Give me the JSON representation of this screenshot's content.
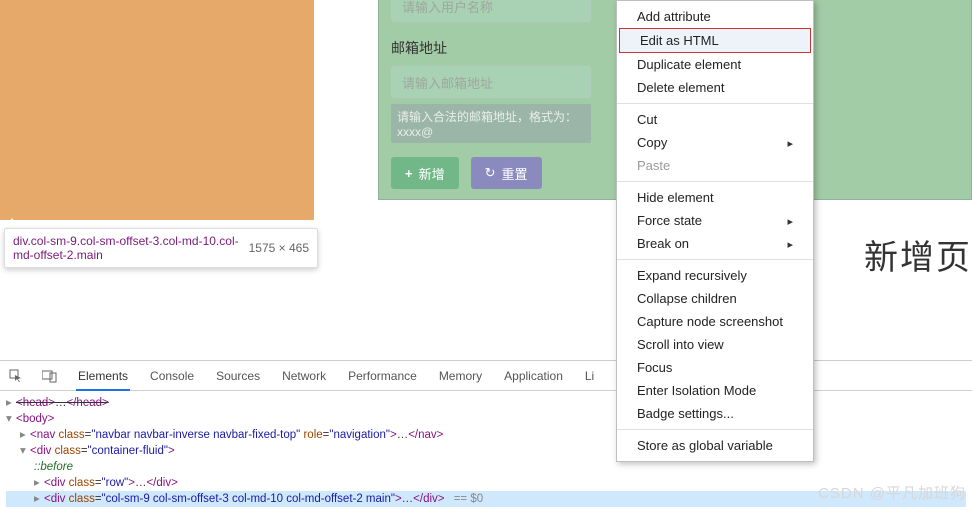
{
  "tooltip": {
    "selector": "div.col-sm-9.col-sm-offset-3.col-md-10.col-md-offset-2.main",
    "dimensions": "1575 × 465"
  },
  "form": {
    "username_placeholder": "请输入用户名称",
    "email_label": "邮箱地址",
    "email_placeholder": "请输入邮箱地址",
    "email_hint": "请输入合法的邮箱地址，格式为： xxxx@",
    "add_btn": "新增",
    "reset_btn": "重置"
  },
  "sidetext": "新增页",
  "devtools": {
    "tabs": [
      "Elements",
      "Console",
      "Sources",
      "Network",
      "Performance",
      "Memory",
      "Application",
      "Li"
    ],
    "dom": {
      "head_close": "</head>",
      "body_open": "<body>",
      "nav": {
        "open": "<nav class=\"navbar navbar-inverse navbar-fixed-top\" role=\"navigation\">",
        "ell": "…",
        "close": "</nav>"
      },
      "container": {
        "open": "<div class=\"container-fluid\">"
      },
      "before": "::before",
      "row": {
        "open": "<div class=\"row\">",
        "ell": "…",
        "close": "</div>"
      },
      "main": {
        "open": "<div class=\"col-sm-9 col-sm-offset-3 col-md-10 col-md-offset-2 main\">",
        "ell": "…",
        "close": "</div>",
        "eq": " == $0"
      }
    }
  },
  "context_menu": {
    "items": [
      {
        "label": "Add attribute",
        "type": "normal"
      },
      {
        "label": "Edit as HTML",
        "type": "boxed_highlight"
      },
      {
        "label": "Duplicate element",
        "type": "normal"
      },
      {
        "label": "Delete element",
        "type": "normal"
      },
      {
        "type": "sep"
      },
      {
        "label": "Cut",
        "type": "normal"
      },
      {
        "label": "Copy",
        "type": "submenu"
      },
      {
        "label": "Paste",
        "type": "disabled"
      },
      {
        "type": "sep"
      },
      {
        "label": "Hide element",
        "type": "normal"
      },
      {
        "label": "Force state",
        "type": "submenu"
      },
      {
        "label": "Break on",
        "type": "submenu"
      },
      {
        "type": "sep"
      },
      {
        "label": "Expand recursively",
        "type": "normal"
      },
      {
        "label": "Collapse children",
        "type": "normal"
      },
      {
        "label": "Capture node screenshot",
        "type": "normal"
      },
      {
        "label": "Scroll into view",
        "type": "normal"
      },
      {
        "label": "Focus",
        "type": "normal"
      },
      {
        "label": "Enter Isolation Mode",
        "type": "normal"
      },
      {
        "label": "Badge settings...",
        "type": "normal"
      },
      {
        "type": "sep"
      },
      {
        "label": "Store as global variable",
        "type": "normal"
      }
    ]
  },
  "watermark": "CSDN @平凡加班狗"
}
